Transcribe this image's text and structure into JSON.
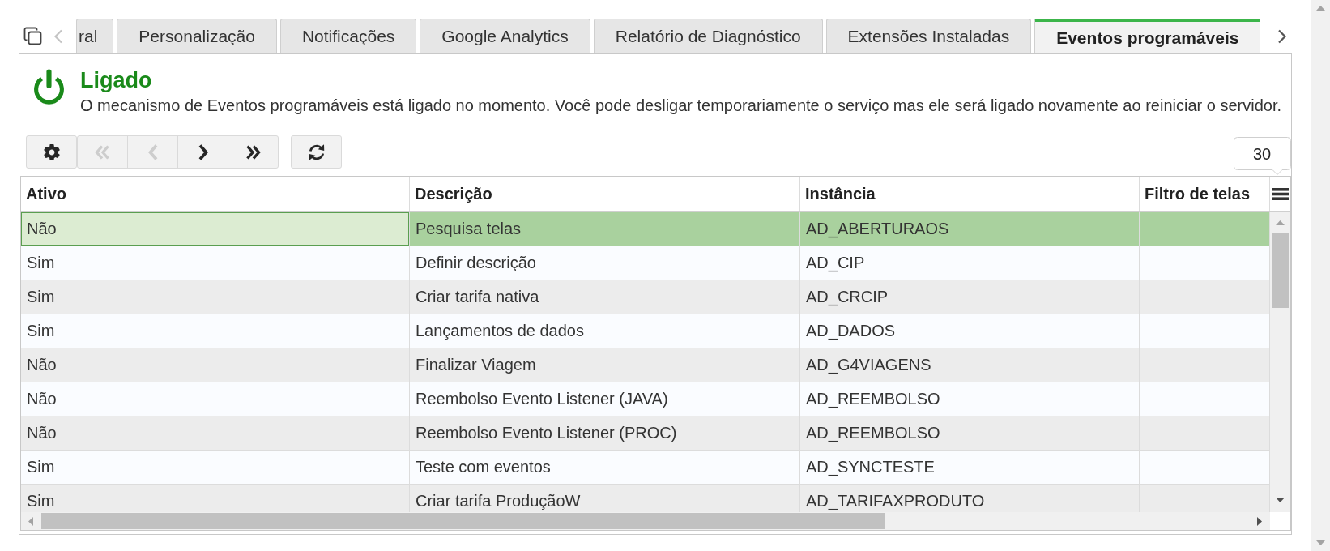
{
  "tab_scroll": [
    {
      "kind": "back",
      "disabled": true
    },
    {
      "kind": "forward",
      "disabled": false
    }
  ],
  "tabs": [
    {
      "label": "ral",
      "selected": false
    },
    {
      "label": "Personalização",
      "selected": false
    },
    {
      "label": "Notificações",
      "selected": false
    },
    {
      "label": "Google Analytics",
      "selected": false
    },
    {
      "label": "Relatório de Diagnóstico",
      "selected": false
    },
    {
      "label": "Extensões Instaladas",
      "selected": false
    },
    {
      "label": "Eventos programáveis",
      "selected": true
    }
  ],
  "status": {
    "on": true,
    "title": "Ligado",
    "message": "O mecanismo de Eventos programáveis está ligado no momento. Você pode desligar temporariamente o serviço mas ele será ligado novamente ao reiniciar o servidor."
  },
  "toolbar": [
    {
      "kind": "settings",
      "disabled": false
    },
    {
      "kind": "first",
      "disabled": true
    },
    {
      "kind": "previous",
      "disabled": true
    },
    {
      "kind": "next",
      "disabled": false
    },
    {
      "kind": "last",
      "disabled": false
    },
    {
      "kind": "refresh",
      "disabled": false
    }
  ],
  "page_size": "30",
  "table": {
    "columns": [
      "Ativo",
      "Descrição",
      "Instância",
      "Filtro de telas"
    ],
    "rows": [
      {
        "selected": true,
        "cells": [
          "Não",
          "Pesquisa telas",
          "AD_ABERTURAOS"
        ]
      },
      {
        "selected": false,
        "cells": [
          "Sim",
          "Definir descrição",
          "AD_CIP"
        ]
      },
      {
        "selected": false,
        "cells": [
          "Sim",
          "Criar tarifa nativa",
          "AD_CRCIP"
        ]
      },
      {
        "selected": false,
        "cells": [
          "Sim",
          "Lançamentos de dados",
          "AD_DADOS"
        ]
      },
      {
        "selected": false,
        "cells": [
          "Não",
          "Finalizar Viagem",
          "AD_G4VIAGENS"
        ]
      },
      {
        "selected": false,
        "cells": [
          "Não",
          "Reembolso Evento Listener (JAVA)",
          "AD_REEMBOLSO"
        ]
      },
      {
        "selected": false,
        "cells": [
          "Não",
          "Reembolso Evento Listener (PROC)",
          "AD_REEMBOLSO"
        ]
      },
      {
        "selected": false,
        "cells": [
          "Sim",
          "Teste com eventos",
          "AD_SYNCTESTE"
        ]
      },
      {
        "selected": false,
        "cells": [
          "Sim",
          "Criar tarifa ProduçãoW",
          "AD_TARIFAXPRODUTO"
        ]
      }
    ]
  }
}
